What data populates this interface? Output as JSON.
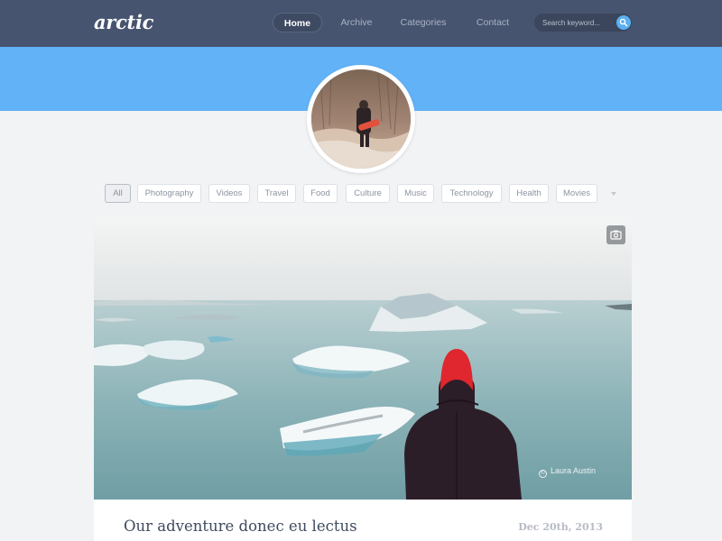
{
  "brand": {
    "logo": "arctic"
  },
  "nav": {
    "items": [
      {
        "label": "Home",
        "active": true
      },
      {
        "label": "Archive",
        "active": false
      },
      {
        "label": "Categories",
        "active": false
      },
      {
        "label": "Contact",
        "active": false
      }
    ],
    "search": {
      "placeholder": "Search keyword..."
    }
  },
  "colors": {
    "nav_bg": "#47546f",
    "hero_band": "#62b2f7",
    "accent": "#5ab0f2",
    "page_bg": "#f2f3f5"
  },
  "filters": {
    "items": [
      {
        "label": "All",
        "active": true
      },
      {
        "label": "Photography"
      },
      {
        "label": "Videos"
      },
      {
        "label": "Travel"
      },
      {
        "label": "Food"
      },
      {
        "label": "Culture"
      },
      {
        "label": "Music"
      },
      {
        "label": "Technology"
      },
      {
        "label": "Health"
      },
      {
        "label": "Movies"
      }
    ],
    "more_icon": "caret-down-icon"
  },
  "post": {
    "title": "Our adventure donec eu lectus",
    "date": "Dec 20th, 2013",
    "photo_credit": "Laura Austin",
    "camera_icon": "camera-icon"
  }
}
